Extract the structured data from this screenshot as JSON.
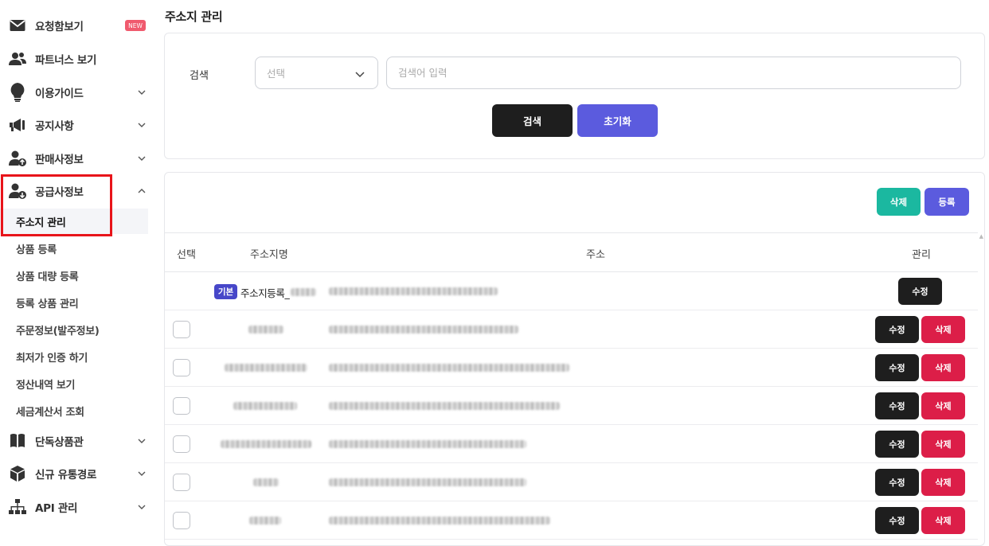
{
  "sidebar": {
    "menu": [
      {
        "label": "요청함보기",
        "icon": "envelope-icon",
        "badge": "NEW"
      },
      {
        "label": "파트너스 보기",
        "icon": "users-icon"
      },
      {
        "label": "이용가이드",
        "icon": "lightbulb-icon"
      },
      {
        "label": "공지사항",
        "icon": "megaphone-icon"
      },
      {
        "label": "판매사정보",
        "icon": "user-upload-icon"
      },
      {
        "label": "공급사정보",
        "icon": "user-download-icon"
      }
    ],
    "submenu": [
      {
        "label": "주소지 관리",
        "active": true
      },
      {
        "label": "상품 등록"
      },
      {
        "label": "상품 대량 등록"
      },
      {
        "label": "등록 상품 관리"
      },
      {
        "label": "주문정보(발주정보)"
      },
      {
        "label": "최저가 인증 하기"
      },
      {
        "label": "정산내역 보기"
      },
      {
        "label": "세금계산서 조회"
      }
    ],
    "menu_bottom": [
      {
        "label": "단독상품관",
        "icon": "book-icon"
      },
      {
        "label": "신규 유통경로",
        "icon": "cube-icon"
      },
      {
        "label": "API 관리",
        "icon": "sitemap-icon"
      }
    ]
  },
  "page": {
    "title": "주소지 관리"
  },
  "search": {
    "label": "검색",
    "select_placeholder": "선택",
    "input_placeholder": "검색어 입력",
    "search_button": "검색",
    "reset_button": "초기화"
  },
  "list": {
    "delete_button": "삭제",
    "register_button": "등록",
    "columns": {
      "select": "선택",
      "name": "주소지명",
      "address": "주소",
      "manage": "관리"
    },
    "default_row": {
      "badge": "기본",
      "name": "주소지등록_",
      "edit": "수정"
    },
    "edit_label": "수정",
    "delete_label": "삭제"
  },
  "colors": {
    "accent": "#5b5bde",
    "danger": "#dc1e48",
    "teal": "#1bb8a0",
    "dark": "#1e1e1e",
    "highlight_box": "#e8141a"
  }
}
